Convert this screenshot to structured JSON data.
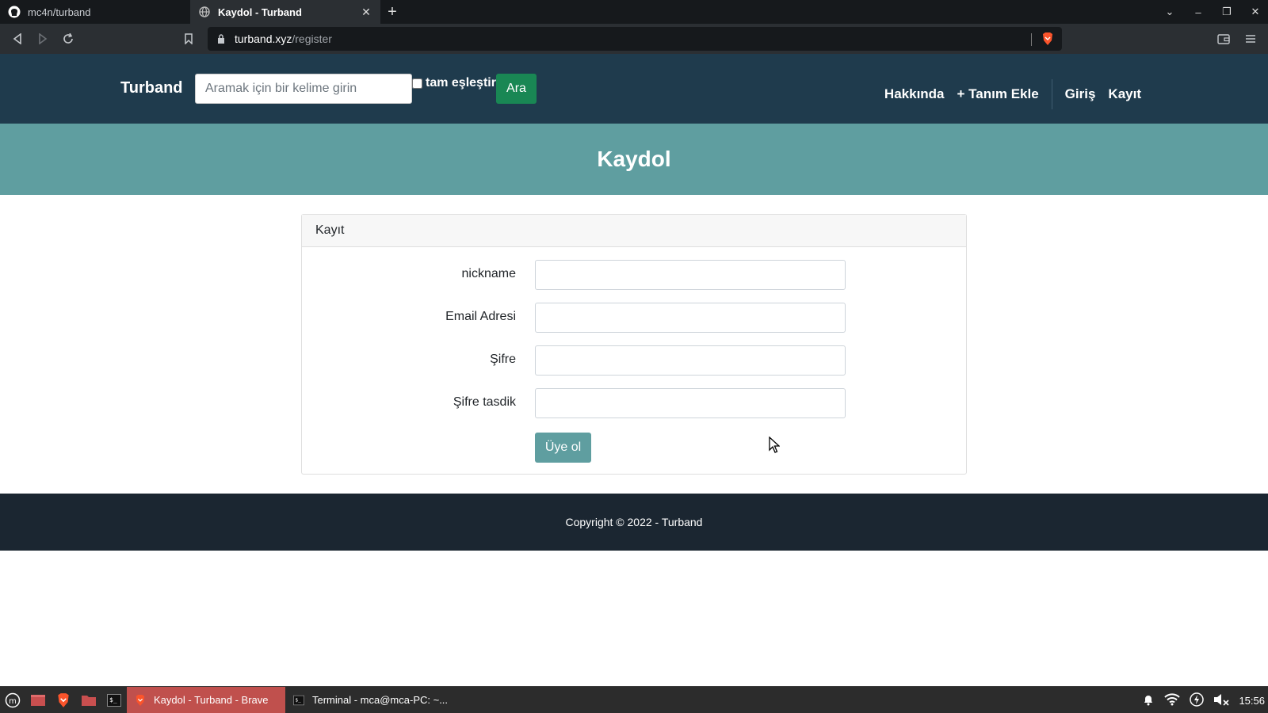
{
  "browser": {
    "tabs": [
      {
        "title": "mc4n/turband",
        "icon": "github-icon",
        "active": false
      },
      {
        "title": "Kaydol - Turband",
        "icon": "globe-icon",
        "active": true
      }
    ],
    "url_host": "turband.xyz",
    "url_path": "/register"
  },
  "site": {
    "brand": "Turband",
    "search_placeholder": "Aramak için bir kelime girin",
    "exact_match_label": "tam eşleştir",
    "search_button": "Ara",
    "nav": {
      "about": "Hakkında",
      "add_definition": "+ Tanım Ekle",
      "login": "Giriş",
      "register": "Kayıt"
    }
  },
  "banner": {
    "title": "Kaydol"
  },
  "card": {
    "header": "Kayıt",
    "fields": [
      {
        "label": "nickname",
        "value": ""
      },
      {
        "label": "Email Adresi",
        "value": ""
      },
      {
        "label": "Şifre",
        "value": ""
      },
      {
        "label": "Şifre tasdik",
        "value": ""
      }
    ],
    "submit": "Üye ol"
  },
  "footer": {
    "text": "Copyright © 2022 - Turband"
  },
  "taskbar": {
    "tasks": [
      {
        "label": "Kaydol - Turband - Brave",
        "active": true
      },
      {
        "label": "Terminal - mca@mca-PC: ~...",
        "active": false
      }
    ],
    "clock": "15:56"
  },
  "colors": {
    "navbar": "#1f3b4d",
    "banner": "#5f9ea0",
    "search_button": "#198754",
    "footer": "#1b2631"
  }
}
